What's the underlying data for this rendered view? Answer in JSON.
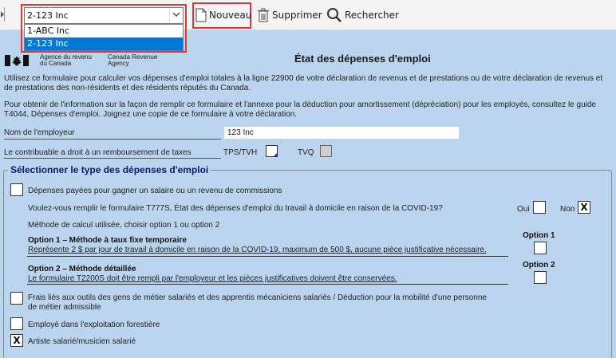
{
  "toolbar": {
    "client_combo_value": "2-123 Inc",
    "client_options": [
      "1-ABC Inc",
      "2-123 Inc"
    ],
    "new_label": "Nouveau",
    "delete_label": "Supprimer",
    "search_label": "Rechercher"
  },
  "header": {
    "dept_fr": "Agence du revenu du Canada",
    "dept_en": "Canada Revenue Agency",
    "title": "État des dépenses d'emploi"
  },
  "intro": {
    "para1": "Utilisez ce formulaire pour calculer vos dépenses d'emploi totales à la ligne 22900 de votre déclaration de revenus et de prestations ou de votre déclaration de revenus et de prestations des non-résidents et des résidents réputés du Canada.",
    "para2": "Pour obtenir de l'information sur la façon de remplir ce formulaire et l'annexe pour la déduction pour amortissement (dépréciation) pour les employés, consultez le guide T4044, Dépenses d'emploi. Joignez une copie de ce formulaire à votre déclaration."
  },
  "employer": {
    "label": "Nom de l'employeur",
    "value": "123 Inc"
  },
  "tax_refund": {
    "label": "Le contribuable a droit à un remboursement de taxes",
    "tps_label": "TPS/TVH",
    "tvq_label": "TVQ"
  },
  "section": {
    "legend": "Sélectionner le type des dépenses d'emploi",
    "salary_label": "Dépenses payées pour gagner un salaire ou un revenu de commissions",
    "t777s_question": "Voulez-vous remplir le formulaire T777S, État des dépenses d'emploi du travail à domicile en raison de la COVID-19?",
    "oui_label": "Oui",
    "non_label": "Non",
    "non_value": "X",
    "method_label": "Méthode de calcul utilisée, choisir option 1 ou option 2",
    "option1_title": "Option 1 – Méthode à taux fixe temporaire",
    "option1_desc": "Représente 2 $ par jour de travail à domicile en raison de la COVID-19, maximum de 500 $, aucune pièce justificative nécessaire.",
    "option1_head": "Option 1",
    "option2_title": "Option 2 – Méthode détaillée",
    "option2_desc": "Le formulaire T2200S doit être rempli par l'employeur et les pièces justificatives doivent être conservées.",
    "option2_head": "Option 2",
    "tools_label": "Frais liés aux outils des gens de métier salariés et des apprentis mécaniciens salariés / Déduction pour la mobilité d'une personne de métier admissible",
    "forestry_label": "Employé dans l'exploitation forestière",
    "artist_label": "Artiste salarié/musicien salarié",
    "artist_value": "X"
  },
  "colors": {
    "form_background": "#bcd5ee",
    "highlight_red": "#e0353d",
    "selected_blue": "#0078d7",
    "legend_navy": "#0a1a6b"
  }
}
